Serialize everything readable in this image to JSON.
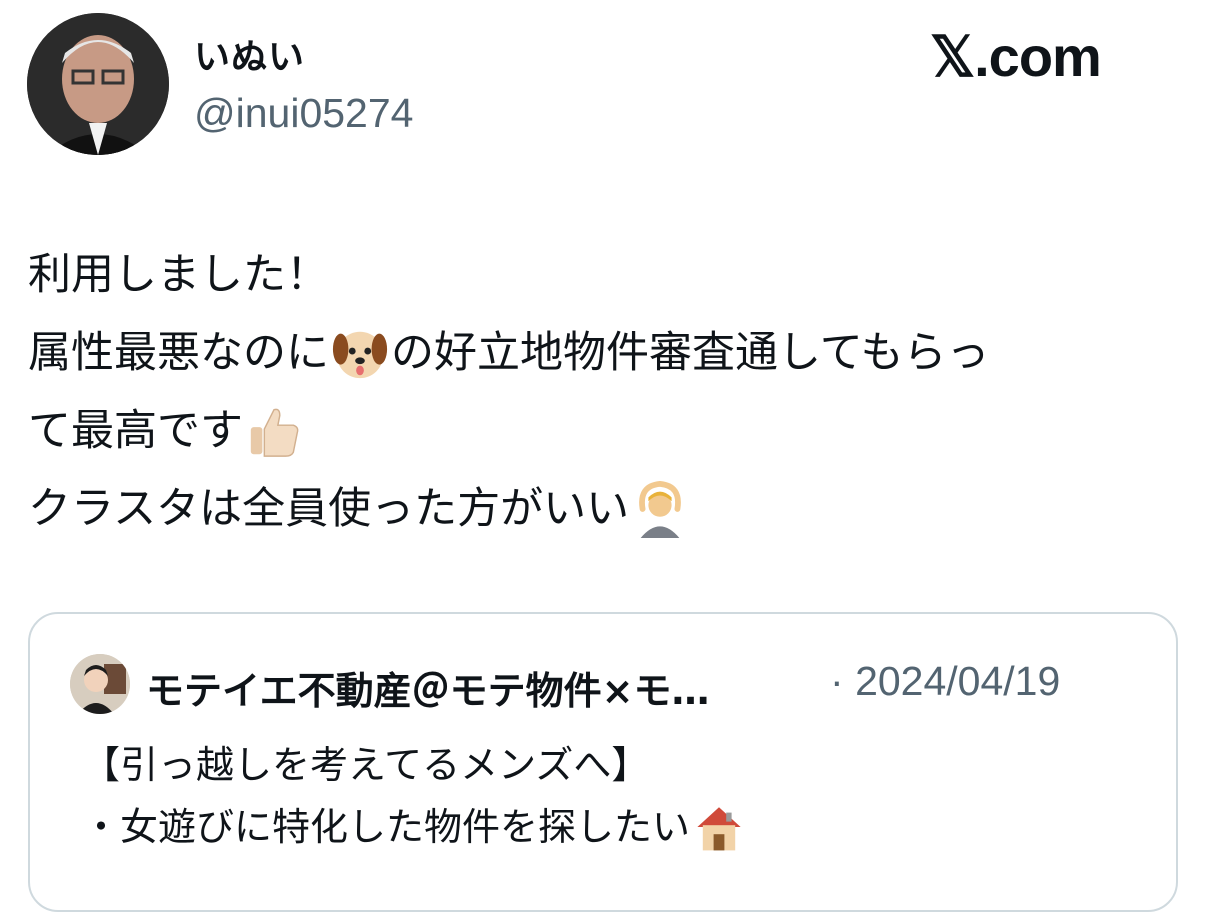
{
  "tweet": {
    "display_name": "いぬい",
    "handle": "@inui05274",
    "brand": "𝕏.com",
    "lines": [
      {
        "text": "利用しました！",
        "emoji": "",
        "after": ""
      },
      {
        "text": "属性最悪なのに",
        "emoji": "dog-face",
        "after": "の好立地物件審査通してもらっ"
      },
      {
        "text": "て最高です",
        "emoji": "thumbs-up",
        "after": ""
      },
      {
        "text": "クラスタは全員使った方がいい",
        "emoji": "person-gesturing-ok",
        "after": ""
      }
    ]
  },
  "quote": {
    "name": "モテイエ不動産＠モテ物件×モ…",
    "separator": "·",
    "date": "2024/04/19",
    "lines": [
      {
        "text": "【引っ越しを考えてるメンズへ】",
        "emoji": ""
      },
      {
        "text": "・女遊びに特化した物件を探したい",
        "emoji": "house"
      }
    ]
  },
  "colors": {
    "text": "#0f1419",
    "secondary": "#536471",
    "border": "#cfd9de"
  }
}
